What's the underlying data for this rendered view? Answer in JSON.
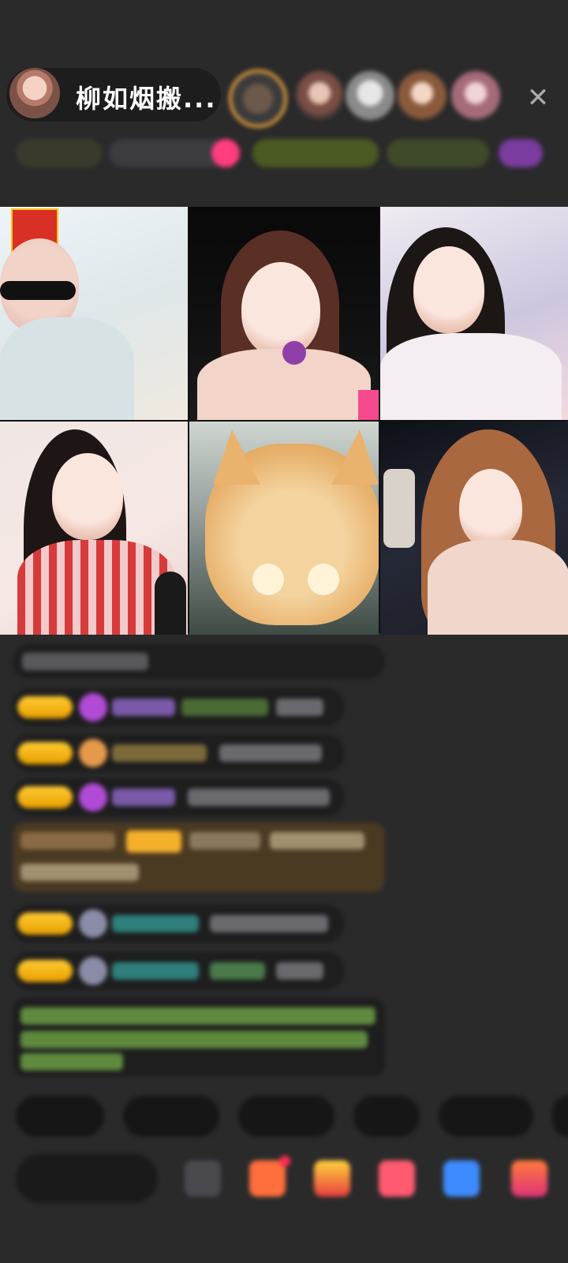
{
  "host": {
    "name": "柳如烟搬..."
  },
  "header": {
    "close_icon": "close-icon"
  },
  "colors": {
    "background": "#2a2a2b",
    "badge_gold": "#ffcc33",
    "chat_green": "#8ed36a",
    "chat_teal": "#3aa7a3"
  },
  "streams": [
    {
      "name": "stream-tile-1"
    },
    {
      "name": "stream-tile-2"
    },
    {
      "name": "stream-tile-3"
    },
    {
      "name": "stream-tile-4"
    },
    {
      "name": "stream-tile-5"
    },
    {
      "name": "stream-tile-6"
    }
  ]
}
